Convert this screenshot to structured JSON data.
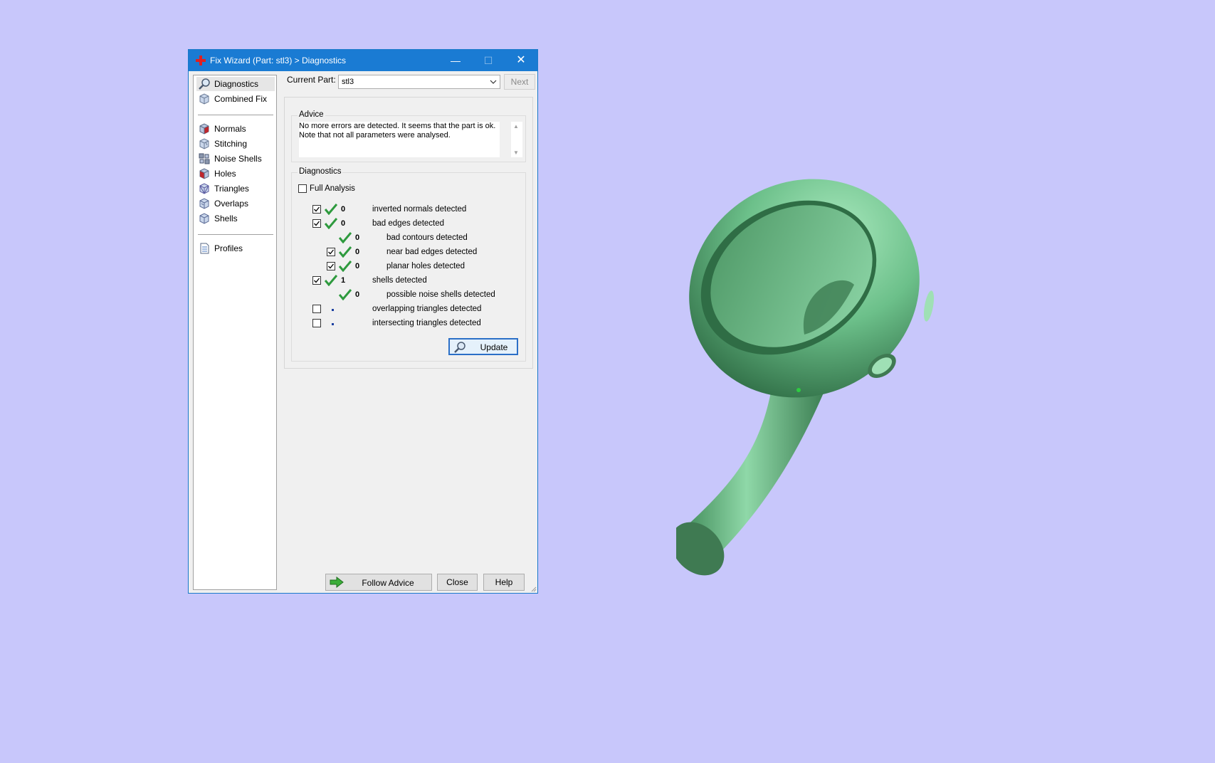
{
  "window": {
    "title": "Fix Wizard (Part: stl3) > Diagnostics",
    "minimize_glyph": "—",
    "maximize_glyph": "☐",
    "close_glyph": "✕"
  },
  "sidebar": {
    "items": [
      {
        "label": "Diagnostics",
        "icon": "magnifier-icon",
        "selected": true
      },
      {
        "label": "Combined Fix",
        "icon": "cube-icon"
      },
      {
        "label": "Normals",
        "icon": "normals-cube-icon"
      },
      {
        "label": "Stitching",
        "icon": "stitching-cube-icon"
      },
      {
        "label": "Noise Shells",
        "icon": "noise-shells-icon"
      },
      {
        "label": "Holes",
        "icon": "holes-cube-icon"
      },
      {
        "label": "Triangles",
        "icon": "triangles-cube-icon"
      },
      {
        "label": "Overlaps",
        "icon": "overlaps-cube-icon"
      },
      {
        "label": "Shells",
        "icon": "shells-cube-icon"
      },
      {
        "label": "Profiles",
        "icon": "document-icon"
      }
    ]
  },
  "main": {
    "current_part_label": "Current Part:",
    "current_part_value": "stl3",
    "next_label": "Next",
    "advice": {
      "title": "Advice",
      "line1": "No more errors are detected. It seems that the part is ok.",
      "line2": "Note that not all parameters were analysed."
    },
    "diagnostics": {
      "title": "Diagnostics",
      "full_analysis_label": "Full Analysis",
      "full_analysis_checked": false,
      "rows": [
        {
          "checkbox": true,
          "checked": true,
          "status": "ok",
          "count": "0",
          "label": "inverted normals detected",
          "indent": 0
        },
        {
          "checkbox": true,
          "checked": true,
          "status": "ok",
          "count": "0",
          "label": "bad edges detected",
          "indent": 0
        },
        {
          "checkbox": false,
          "checked": false,
          "status": "ok",
          "count": "0",
          "label": "bad contours detected",
          "indent": 1
        },
        {
          "checkbox": true,
          "checked": true,
          "status": "ok",
          "count": "0",
          "label": "near bad edges detected",
          "indent": 1
        },
        {
          "checkbox": true,
          "checked": true,
          "status": "ok",
          "count": "0",
          "label": "planar holes detected",
          "indent": 1
        },
        {
          "checkbox": true,
          "checked": true,
          "status": "ok",
          "count": "1",
          "label": "shells detected",
          "indent": 0
        },
        {
          "checkbox": false,
          "checked": false,
          "status": "ok",
          "count": "0",
          "label": "possible noise shells detected",
          "indent": 1
        },
        {
          "checkbox": true,
          "checked": false,
          "status": "none",
          "count": "",
          "label": "overlapping triangles detected",
          "indent": 0
        },
        {
          "checkbox": true,
          "checked": false,
          "status": "none",
          "count": "",
          "label": "intersecting triangles detected",
          "indent": 0
        }
      ],
      "update_label": "Update"
    }
  },
  "footer": {
    "follow_advice_label": "Follow Advice",
    "close_label": "Close",
    "help_label": "Help"
  },
  "colors": {
    "desktop_bg": "#c8c7fb",
    "titlebar": "#1a7bd3",
    "check_green": "#2e9a3e",
    "model_green": "#6cc08a"
  }
}
